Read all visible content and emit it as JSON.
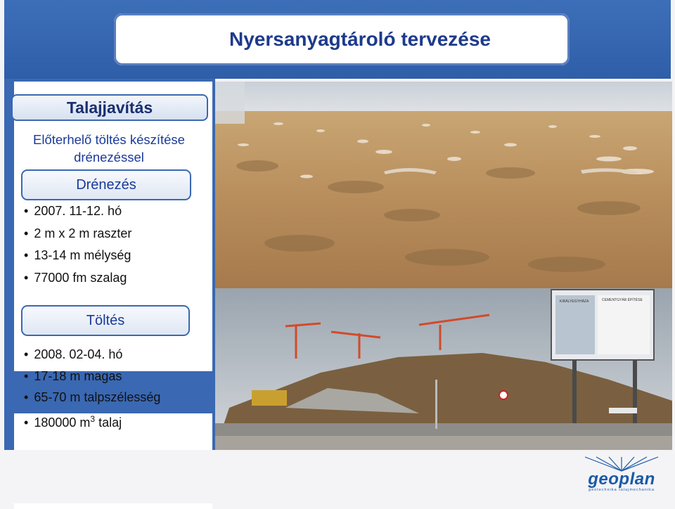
{
  "header": {
    "title": "Nyersanyagtároló tervezése"
  },
  "main": {
    "title": "Talajjavítás",
    "subtitle_line1": "Előterhelő töltés készítése",
    "subtitle_line2": "drénezéssel"
  },
  "sections": [
    {
      "label": "Drénezés",
      "items": [
        "2007. 11-12. hó",
        "2 m x 2 m raszter",
        "13-14 m mélység",
        "77000 fm szalag"
      ]
    },
    {
      "label": "Töltés",
      "items": [
        "2008. 02-04. hó",
        "17-18 m magas",
        "65-70 m talpszélesség"
      ],
      "last_item_prefix": "180000 m",
      "last_item_sup": "3",
      "last_item_suffix": " talaj"
    }
  ],
  "photos": {
    "top_sign_text_1": "KIRÁLYEGYHÁZA",
    "top_sign_text_2": "CEMENTGYÁR ÉPÍTÉSE"
  },
  "logo": {
    "word": "geoplan",
    "tagline": "geotechnika talajmechanika"
  },
  "colors": {
    "brand_blue": "#3a68b2",
    "title_blue": "#1d3a8c",
    "logo_blue": "#1a5aa8"
  }
}
